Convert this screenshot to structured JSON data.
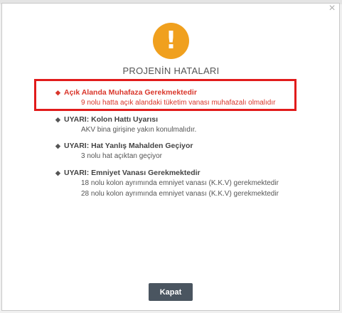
{
  "dialog": {
    "close_glyph": "×",
    "warn_glyph": "!",
    "title": "PROJENİN HATALARI",
    "button_label": "Kapat"
  },
  "issues": [
    {
      "kind": "error",
      "heading": "Açık Alanda Muhafaza Gerekmektedir",
      "details": [
        "9 nolu hatta açık alandaki tüketim vanası muhafazalı olmalıdır"
      ]
    },
    {
      "kind": "warning",
      "heading": "UYARI: Kolon Hattı Uyarısı",
      "details": [
        "AKV bina girişine yakın konulmalıdır."
      ]
    },
    {
      "kind": "warning",
      "heading": "UYARI: Hat Yanlış Mahalden Geçiyor",
      "details": [
        "3 nolu hat açıktan geçiyor"
      ]
    },
    {
      "kind": "warning",
      "heading": "UYARI: Emniyet Vanası Gerekmektedir",
      "details": [
        "18 nolu kolon ayrımında emniyet vanası (K.K.V) gerekmektedir",
        "28 nolu kolon ayrımında emniyet vanası (K.K.V) gerekmektedir"
      ]
    }
  ],
  "colors": {
    "error": "#d9362b",
    "warning": "#444444",
    "highlight": "#e11b1b",
    "accent": "#f0a01e",
    "button": "#4a5560"
  }
}
